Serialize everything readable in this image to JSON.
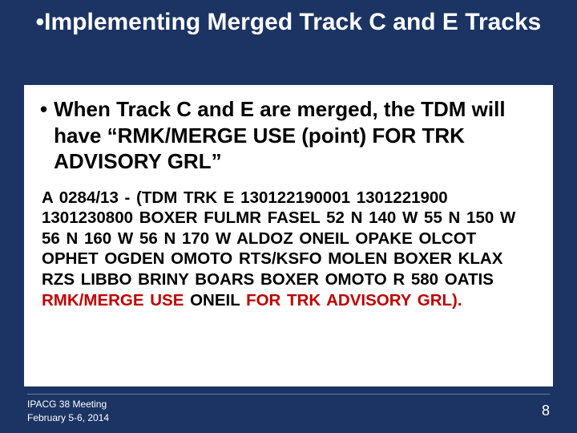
{
  "title_bullet": "•",
  "title_text": "Implementing Merged Track C and E Tracks",
  "content_bullet": "•",
  "heading": "When Track C and E are merged, the TDM will have “RMK/MERGE USE (point) FOR TRK ADVISORY GRL”",
  "body_prefix": "A 0284/13 - (TDM TRK E 130122190001 1301221900 1301230800 BOXER FULMR FASEL 52 N 140 W 55 N 150 W 56 N 160 W 56 N 170 W ALDOZ ONEIL OPAKE OLCOT OPHET OGDEN OMOTO RTS/KSFO MOLEN BOXER KLAX RZS LIBBO BRINY BOARS BOXER OMOTO R 580 OATIS ",
  "body_hl1": "RMK/MERGE USE ",
  "body_mid": "ONEIL",
  "body_hl2": " FOR TRK ADVISORY GRL).",
  "footer_line1": "IPACG 38  Meeting",
  "footer_line2": "February 5-6, 2014",
  "page_number": "8"
}
